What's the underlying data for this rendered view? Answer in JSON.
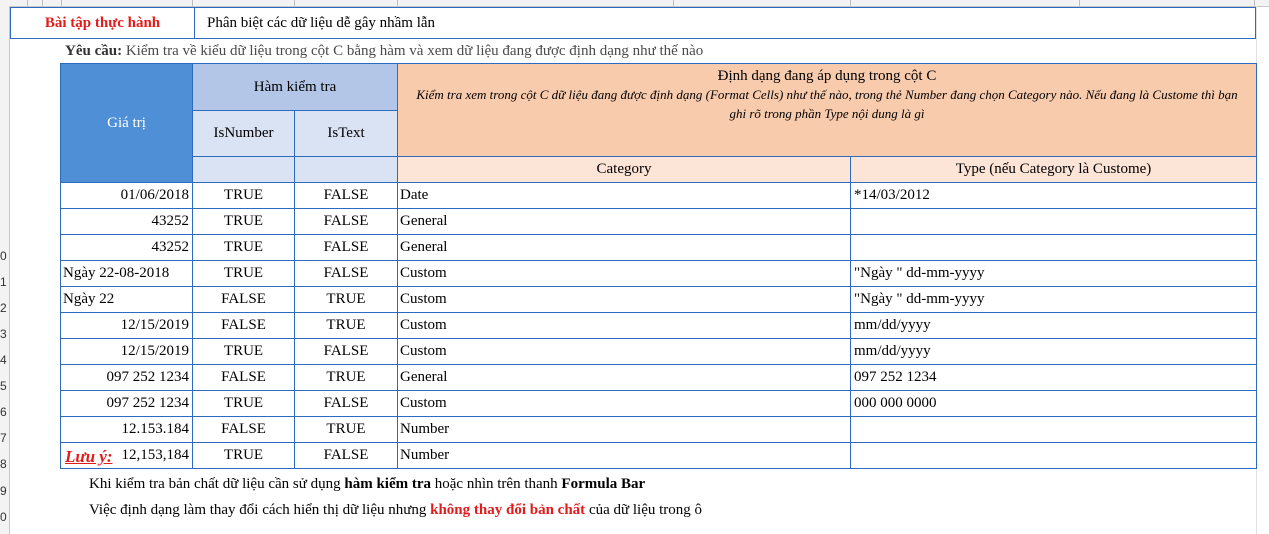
{
  "row_numbers": [
    "0",
    "1",
    "2",
    "3",
    "4",
    "5",
    "6",
    "7",
    "8",
    "9",
    "0"
  ],
  "title": {
    "label": "Bài tập thực hành",
    "text": "Phân biệt các dữ liệu dễ gây nhầm lẫn"
  },
  "requirement": {
    "prefix": "Yêu cầu:",
    "text": " Kiểm tra về kiểu dữ liệu trong cột C bằng hàm và xem dữ liệu đang được định dạng như thế nào"
  },
  "table": {
    "header_value": "Giá trị",
    "header_func": "Hàm kiểm tra",
    "header_isnumber": "IsNumber",
    "header_istext": "IsText",
    "header_format_title": "Định dạng đang áp dụng trong cột C",
    "header_format_desc": "Kiểm tra xem trong cột C dữ liệu đang được định dạng (Format Cells) như thế nào, trong thẻ Number đang chọn Category nào. Nếu đang là Custome thì bạn ghi rõ trong phần Type nội dung là gì",
    "header_category": "Category",
    "header_type": "Type (nếu Category là Custome)",
    "rows": [
      {
        "value": "01/06/2018",
        "align": "r",
        "isnumber": "TRUE",
        "istext": "FALSE",
        "category": "Date",
        "type": "*14/03/2012"
      },
      {
        "value": "43252",
        "align": "r",
        "isnumber": "TRUE",
        "istext": "FALSE",
        "category": "General",
        "type": ""
      },
      {
        "value": "43252",
        "align": "r",
        "isnumber": "TRUE",
        "istext": "FALSE",
        "category": "General",
        "type": ""
      },
      {
        "value": "Ngày 22-08-2018",
        "align": "l",
        "isnumber": "TRUE",
        "istext": "FALSE",
        "category": "Custom",
        "type": "\"Ngày \" dd-mm-yyyy"
      },
      {
        "value": "Ngày 22",
        "align": "l",
        "isnumber": "FALSE",
        "istext": "TRUE",
        "category": "Custom",
        "type": "\"Ngày \" dd-mm-yyyy"
      },
      {
        "value": "12/15/2019",
        "align": "r",
        "isnumber": "FALSE",
        "istext": "TRUE",
        "category": "Custom",
        "type": "mm/dd/yyyy"
      },
      {
        "value": "12/15/2019",
        "align": "r",
        "isnumber": "TRUE",
        "istext": "FALSE",
        "category": "Custom",
        "type": "mm/dd/yyyy"
      },
      {
        "value": "097 252 1234",
        "align": "r",
        "isnumber": "FALSE",
        "istext": "TRUE",
        "category": "General",
        "type": "097 252 1234"
      },
      {
        "value": "097 252 1234",
        "align": "r",
        "isnumber": "TRUE",
        "istext": "FALSE",
        "category": "Custom",
        "type": "000 000 0000"
      },
      {
        "value": "12.153.184",
        "align": "r",
        "isnumber": "FALSE",
        "istext": "TRUE",
        "category": "Number",
        "type": ""
      },
      {
        "value": "12,153,184",
        "align": "r",
        "isnumber": "TRUE",
        "istext": "FALSE",
        "category": "Number",
        "type": ""
      }
    ]
  },
  "notes": {
    "title": "Lưu ý:",
    "line1_a": "Khi kiểm tra bản chất dữ liệu cần sử dụng ",
    "line1_b": "hàm kiểm tra",
    "line1_c": " hoặc nhìn trên thanh ",
    "line1_d": "Formula Bar",
    "line2_a": "Việc định dạng làm thay đổi cách hiển thị dữ liệu nhưng ",
    "line2_b": "không thay đổi bản chất",
    "line2_c": " của dữ liệu trong ô"
  },
  "colors": {
    "accent_blue": "#4f8fd6",
    "border_blue": "#2e6bbf",
    "red": "#e31b1b",
    "orange_header": "#f8cbad"
  }
}
